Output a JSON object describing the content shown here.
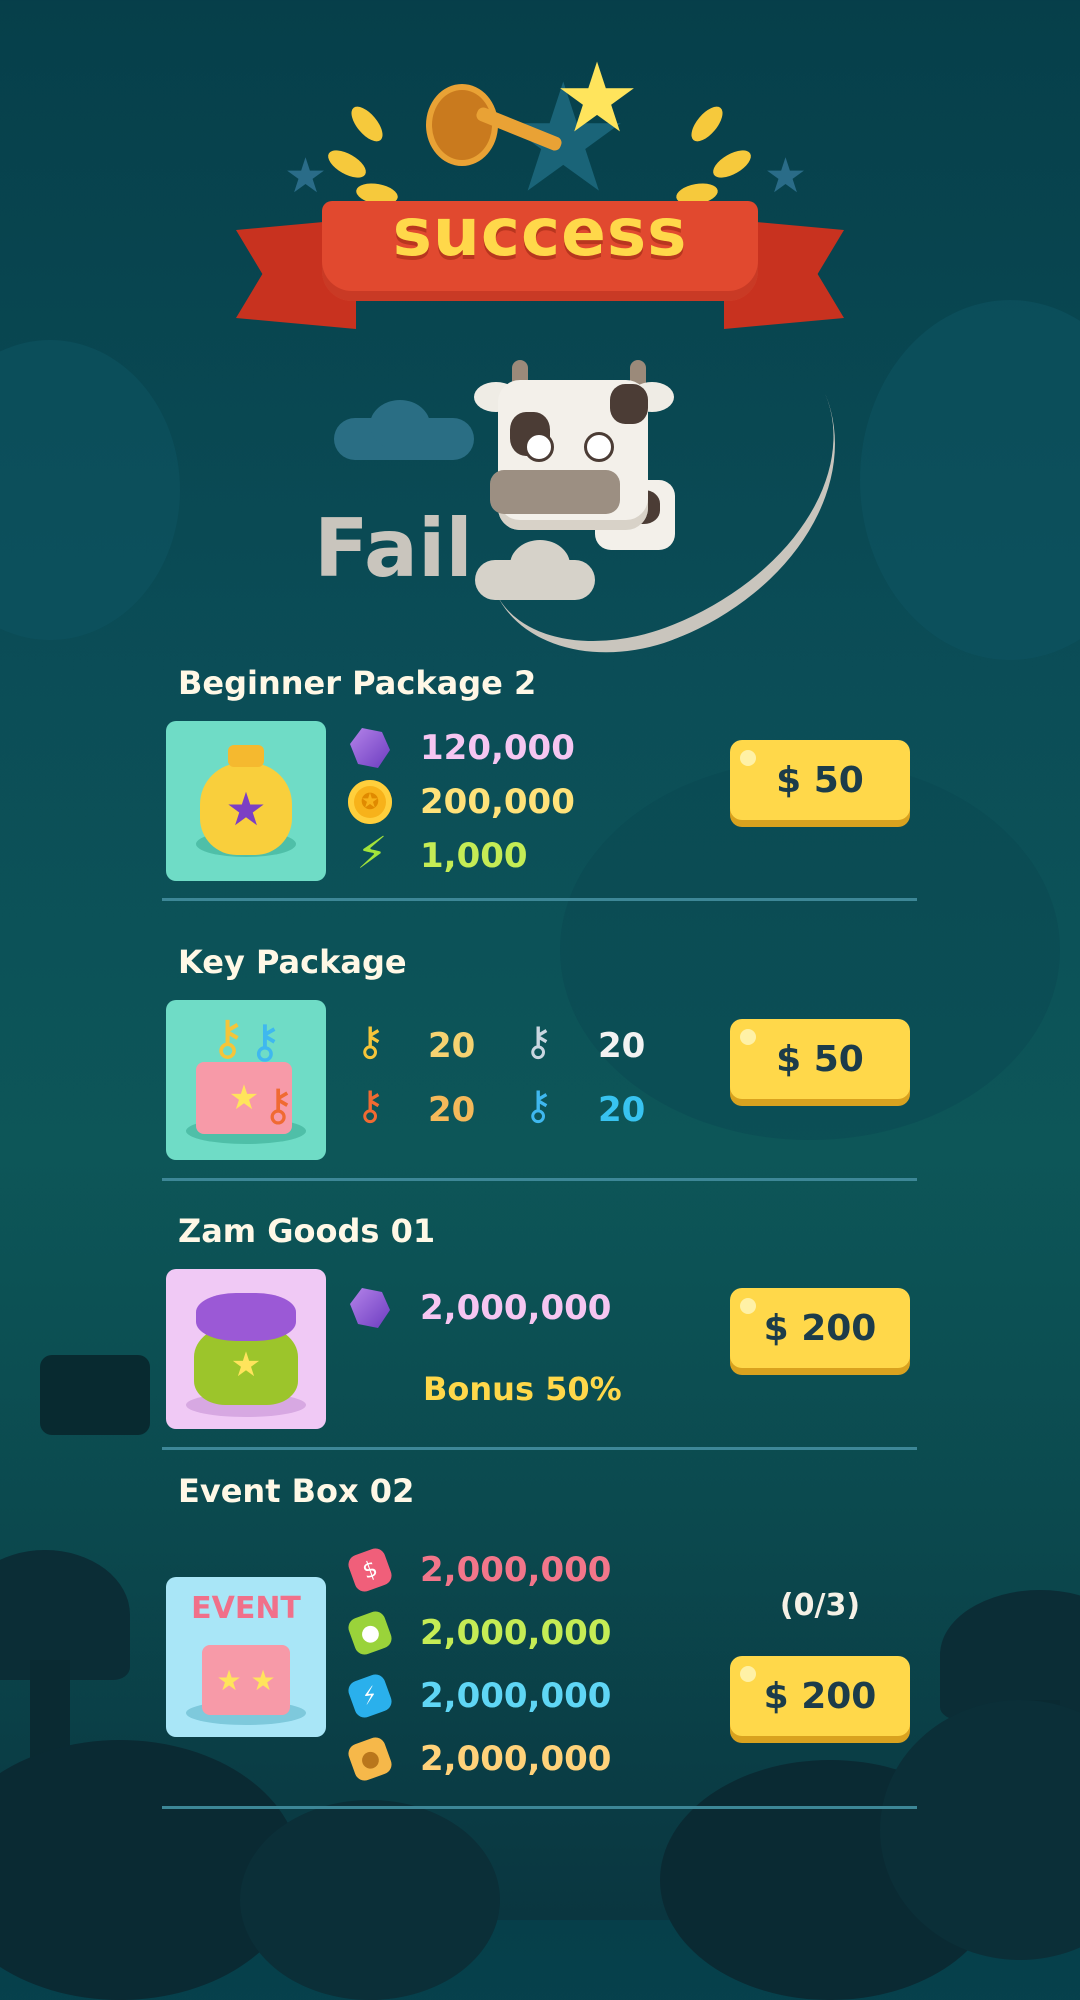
{
  "banner": {
    "title": "success"
  },
  "fail": {
    "label": "Fail"
  },
  "packages": [
    {
      "title": "Beginner Package 2",
      "items": [
        {
          "icon": "gem-icon",
          "amount": "120,000",
          "color": "#f6c6f1"
        },
        {
          "icon": "coin-icon",
          "amount": "200,000",
          "color": "#ffe27a"
        },
        {
          "icon": "energy-icon",
          "amount": "1,000",
          "color": "#c5ec55"
        }
      ],
      "price": "$ 50"
    },
    {
      "title": "Key Package",
      "keys": [
        {
          "icon": "gold-key-icon",
          "amount": "20",
          "color": "#f5d271"
        },
        {
          "icon": "silver-key-icon",
          "amount": "20",
          "color": "#f2f2f2"
        },
        {
          "icon": "orange-key-icon",
          "amount": "20",
          "color": "#f5b95a"
        },
        {
          "icon": "blue-key-icon",
          "amount": "20",
          "color": "#38c3f0"
        }
      ],
      "price": "$ 50"
    },
    {
      "title": "Zam Goods 01",
      "items": [
        {
          "icon": "gem-icon",
          "amount": "2,000,000",
          "color": "#f6c6f1"
        }
      ],
      "bonus": "Bonus 50%",
      "price": "$ 200"
    },
    {
      "title": "Event Box 02",
      "thumb_label": "EVENT",
      "items": [
        {
          "icon": "red-token-icon",
          "amount": "2,000,000",
          "color": "#f2768a"
        },
        {
          "icon": "green-token-icon",
          "amount": "2,000,000",
          "color": "#c5ec55"
        },
        {
          "icon": "blue-token-icon",
          "amount": "2,000,000",
          "color": "#5fd6f5"
        },
        {
          "icon": "cheese-token-icon",
          "amount": "2,000,000",
          "color": "#ffd27a"
        }
      ],
      "limit": "(0/3)",
      "price": "$ 200"
    }
  ]
}
